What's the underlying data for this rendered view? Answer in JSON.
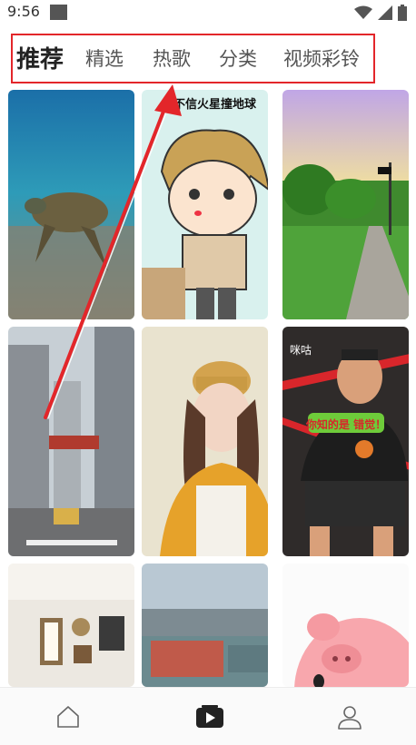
{
  "status_bar": {
    "time": "9:56",
    "icons": [
      "wifi-icon",
      "signal-icon",
      "battery-icon"
    ]
  },
  "tabs": [
    {
      "label": "推荐",
      "active": true
    },
    {
      "label": "精选",
      "active": false
    },
    {
      "label": "热歌",
      "active": false
    },
    {
      "label": "分类",
      "active": false
    },
    {
      "label": "视频彩铃",
      "active": false
    }
  ],
  "grid": {
    "items": [
      {
        "name": "sea-turtle-video",
        "caption": ""
      },
      {
        "name": "cartoon-boy-video",
        "caption": "你不信火星撞地球"
      },
      {
        "name": "garden-path-video",
        "caption": ""
      },
      {
        "name": "city-street-video",
        "caption": ""
      },
      {
        "name": "girl-hat-video",
        "caption": ""
      },
      {
        "name": "basketball-man-video",
        "caption": "你知的是 错觉！",
        "logo": "咪咕"
      },
      {
        "name": "room-frames-video",
        "caption": ""
      },
      {
        "name": "harbor-city-video",
        "caption": ""
      },
      {
        "name": "pink-pig-video",
        "caption": ""
      }
    ]
  },
  "bottom_nav": {
    "items": [
      "home-icon",
      "video-icon",
      "profile-icon"
    ],
    "active": "video-icon"
  },
  "colors": {
    "highlight": "#e3262a",
    "active_tab_text": "#222222",
    "inactive_tab_text": "#555555"
  }
}
